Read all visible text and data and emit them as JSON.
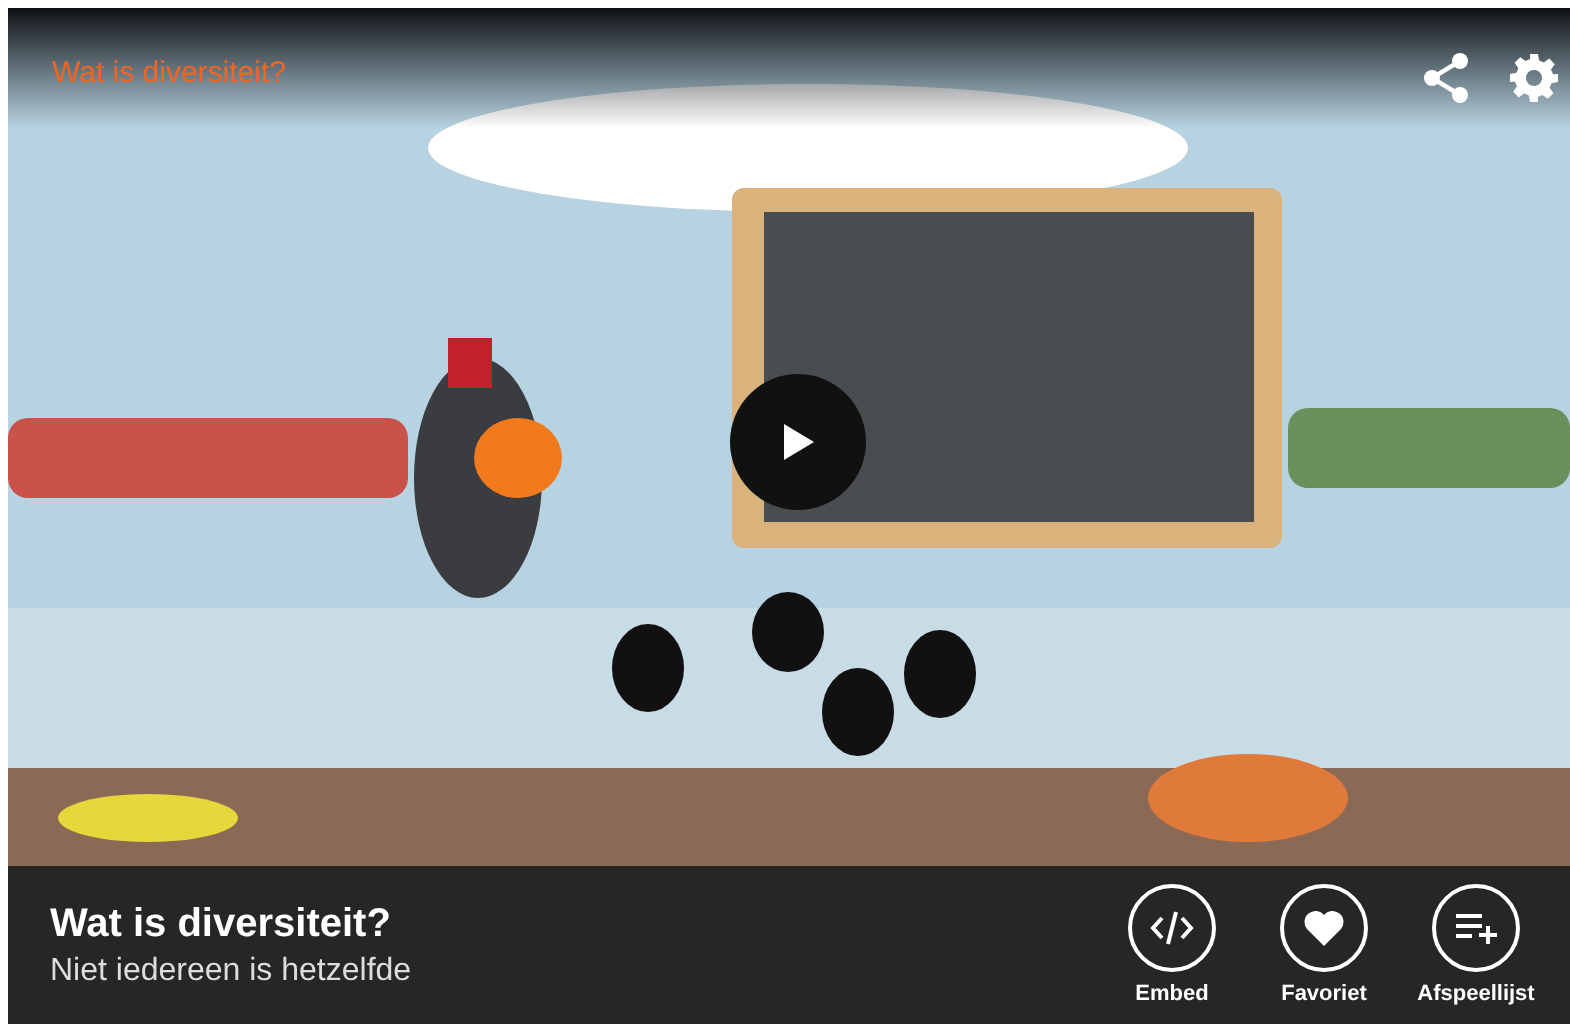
{
  "player": {
    "overlay_title": "Wat is diversiteit?"
  },
  "info_bar": {
    "title": "Wat is diversiteit?",
    "subtitle": "Niet iedereen is hetzelfde",
    "actions": [
      {
        "kind": "embed",
        "label": "Embed"
      },
      {
        "kind": "favorite",
        "label": "Favoriet"
      },
      {
        "kind": "playlist",
        "label": "Afspeellijst"
      }
    ]
  }
}
